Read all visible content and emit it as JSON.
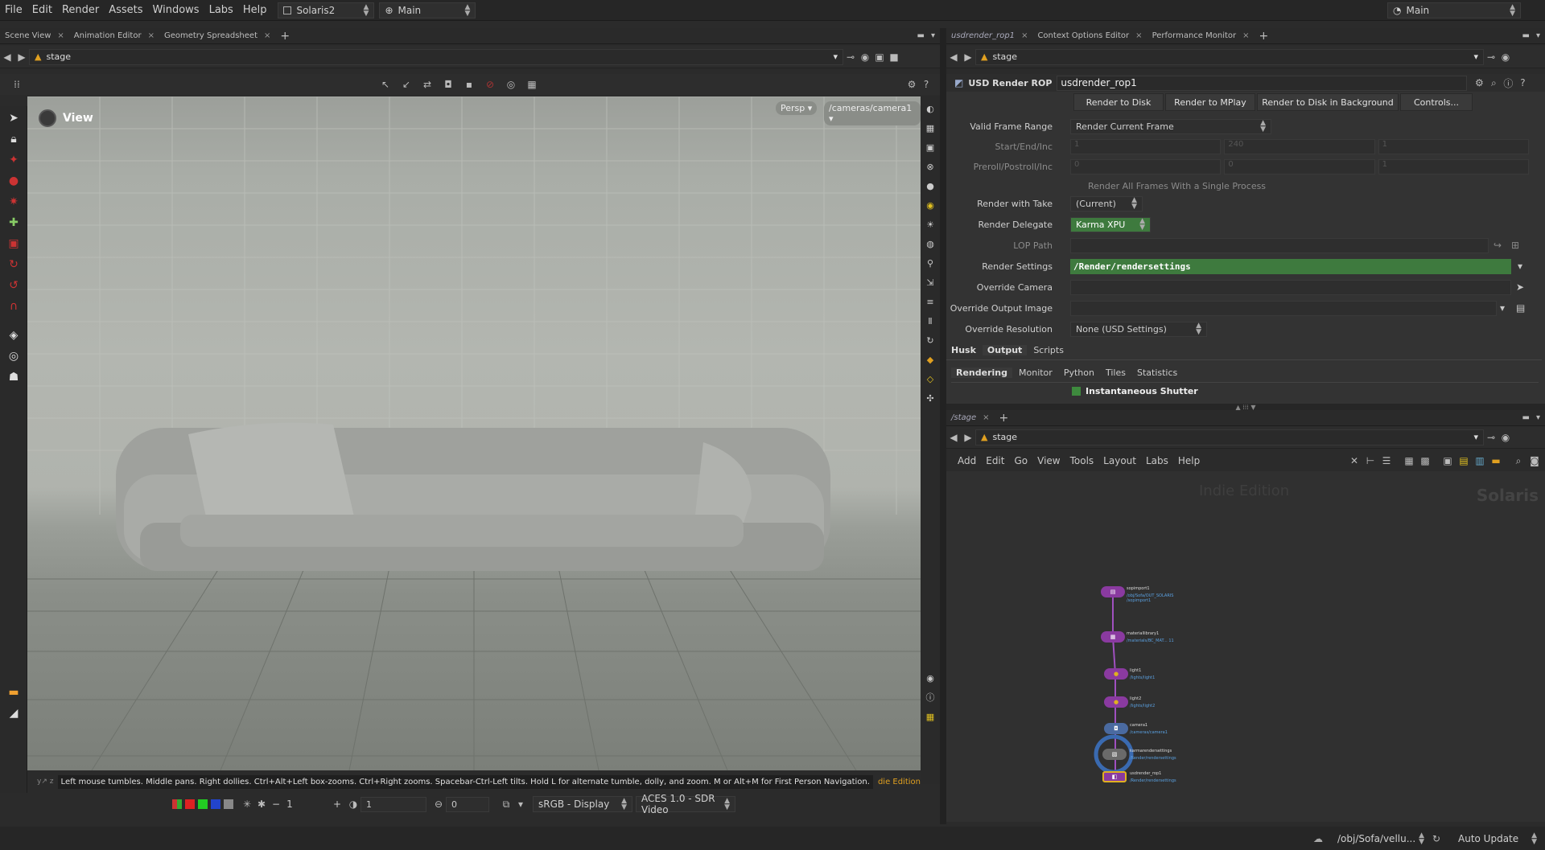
{
  "menubar": {
    "items": [
      "File",
      "Edit",
      "Render",
      "Assets",
      "Windows",
      "Labs",
      "Help"
    ],
    "desktop": "Solaris2",
    "context": "Main",
    "right_desktop": "Main"
  },
  "left_tabs": {
    "tabs": [
      "Scene View",
      "Animation Editor",
      "Geometry Spreadsheet"
    ],
    "add": "+"
  },
  "left_path": {
    "node": "stage"
  },
  "viewport": {
    "label": "View",
    "persp": "Persp",
    "camera": "/cameras/camera1",
    "edition": "die Edition"
  },
  "hint": "Left mouse tumbles. Middle pans. Right dollies. Ctrl+Alt+Left box-zooms. Ctrl+Right zooms. Spacebar-Ctrl-Left tilts. Hold L for alternate tumble, dolly, and zoom. M or Alt+M for First Person Navigation.",
  "bottom_toolbar": {
    "frame1": "1",
    "frame2": "1",
    "frame3": "0",
    "display": "sRGB - Display",
    "view": "ACES 1.0 - SDR Video"
  },
  "right_tabs": {
    "tabs": [
      "usdrender_rop1",
      "Context Options Editor",
      "Performance Monitor"
    ],
    "add": "+"
  },
  "right_path": {
    "node": "stage"
  },
  "params": {
    "type": "USD Render ROP",
    "name": "usdrender_rop1",
    "buttons": [
      "Render to Disk",
      "Render to MPlay",
      "Render to Disk in Background",
      "Controls..."
    ],
    "valid_frame_range": {
      "label": "Valid Frame Range",
      "value": "Render Current Frame"
    },
    "start_end": {
      "label": "Start/End/Inc",
      "values": [
        "1",
        "240",
        "1"
      ]
    },
    "preroll": {
      "label": "Preroll/Postroll/Inc",
      "values": [
        "0",
        "0",
        "1"
      ]
    },
    "single_process": "Render All Frames With a Single Process",
    "take": {
      "label": "Render with Take",
      "value": "(Current)"
    },
    "delegate": {
      "label": "Render Delegate",
      "value": "Karma XPU"
    },
    "lop_path": {
      "label": "LOP Path"
    },
    "render_settings": {
      "label": "Render Settings",
      "value": "/Render/rendersettings"
    },
    "override_camera": {
      "label": "Override Camera"
    },
    "override_output": {
      "label": "Override Output Image"
    },
    "override_res": {
      "label": "Override Resolution",
      "value": "None (USD Settings)"
    },
    "tabs1": [
      "Husk",
      "Output",
      "Scripts"
    ],
    "tabs2": [
      "Rendering",
      "Monitor",
      "Python",
      "Tiles",
      "Statistics"
    ],
    "shutter": "Instantaneous Shutter"
  },
  "network_tabs": {
    "tabs": [
      "/stage"
    ],
    "add": "+"
  },
  "network_path": {
    "node": "stage"
  },
  "network_menu": [
    "Add",
    "Edit",
    "Go",
    "View",
    "Tools",
    "Layout",
    "Labs",
    "Help"
  ],
  "network": {
    "watermark": "Indie Edition",
    "context": "Solaris",
    "nodes": [
      {
        "name": "sopimport1",
        "sub": "/obj/Sofa/OUT_SOLARIS\n/sopimport1"
      },
      {
        "name": "materiallibrary1",
        "sub": "/materials/BC_MAT... 11"
      },
      {
        "name": "light1",
        "sub": "/lights/light1"
      },
      {
        "name": "light2",
        "sub": "/lights/light2"
      },
      {
        "name": "camera1",
        "sub": "/cameras/camera1"
      },
      {
        "name": "karmarendersettings",
        "sub": "/Render/rendersettings"
      },
      {
        "name": "usdrender_rop1",
        "sub": "/Render/rendersettings"
      }
    ]
  },
  "status": {
    "path": "/obj/Sofa/vellu...",
    "update": "Auto Update"
  },
  "colors": {
    "accent_green": "#3e7a3e",
    "node_purple": "#8a3aa0",
    "node_yellow": "#e0b020",
    "selected_blue": "#3a6ab0"
  }
}
